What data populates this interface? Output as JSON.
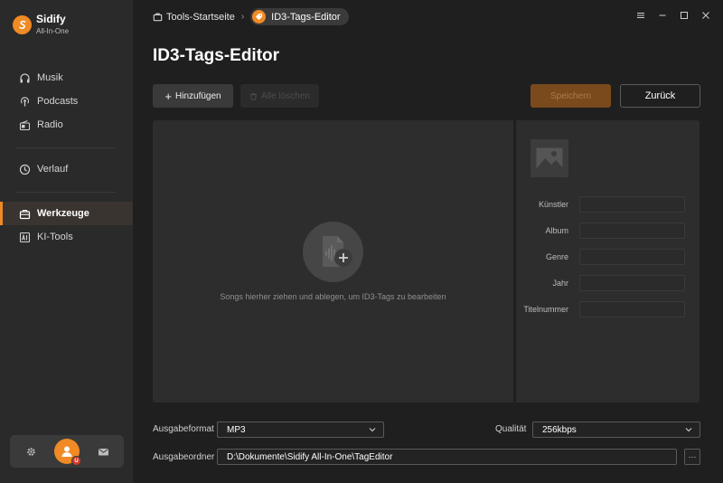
{
  "brand": {
    "name": "Sidify",
    "subtitle": "All-In-One"
  },
  "sidebar": {
    "items": [
      {
        "label": "Musik",
        "icon": "headphones-icon"
      },
      {
        "label": "Podcasts",
        "icon": "podcast-icon"
      },
      {
        "label": "Radio",
        "icon": "radio-icon"
      },
      {
        "label": "Verlauf",
        "icon": "history-icon"
      },
      {
        "label": "Werkzeuge",
        "icon": "toolbox-icon",
        "active": true
      },
      {
        "label": "KI-Tools",
        "icon": "ai-icon"
      }
    ],
    "bottom": {
      "settings_icon": "gear-icon",
      "avatar_icon": "user-avatar",
      "mail_icon": "mail-icon"
    }
  },
  "breadcrumb": {
    "home": "Tools-Startseite",
    "current": "ID3-Tags-Editor"
  },
  "page": {
    "title": "ID3-Tags-Editor"
  },
  "toolbar": {
    "add_label": "Hinzufügen",
    "clear_label": "Alle löschen",
    "save_label": "Speichern",
    "back_label": "Zurück"
  },
  "drop": {
    "hint": "Songs hierher ziehen und ablegen, um ID3-Tags zu bearbeiten"
  },
  "fields": [
    {
      "label": "Künstler",
      "value": ""
    },
    {
      "label": "Album",
      "value": ""
    },
    {
      "label": "Genre",
      "value": ""
    },
    {
      "label": "Jahr",
      "value": ""
    },
    {
      "label": "Titelnummer",
      "value": ""
    }
  ],
  "output": {
    "format_label": "Ausgabeformat",
    "format_value": "MP3",
    "quality_label": "Qualität",
    "quality_value": "256kbps",
    "folder_label": "Ausgabeordner",
    "folder_value": "D:\\Dokumente\\Sidify All-In-One\\TagEditor",
    "more_label": "···"
  },
  "colors": {
    "accent": "#f08a24",
    "background": "#1f1f1f",
    "panel": "#2d2d2d",
    "sidebar": "#2a2a2a"
  }
}
